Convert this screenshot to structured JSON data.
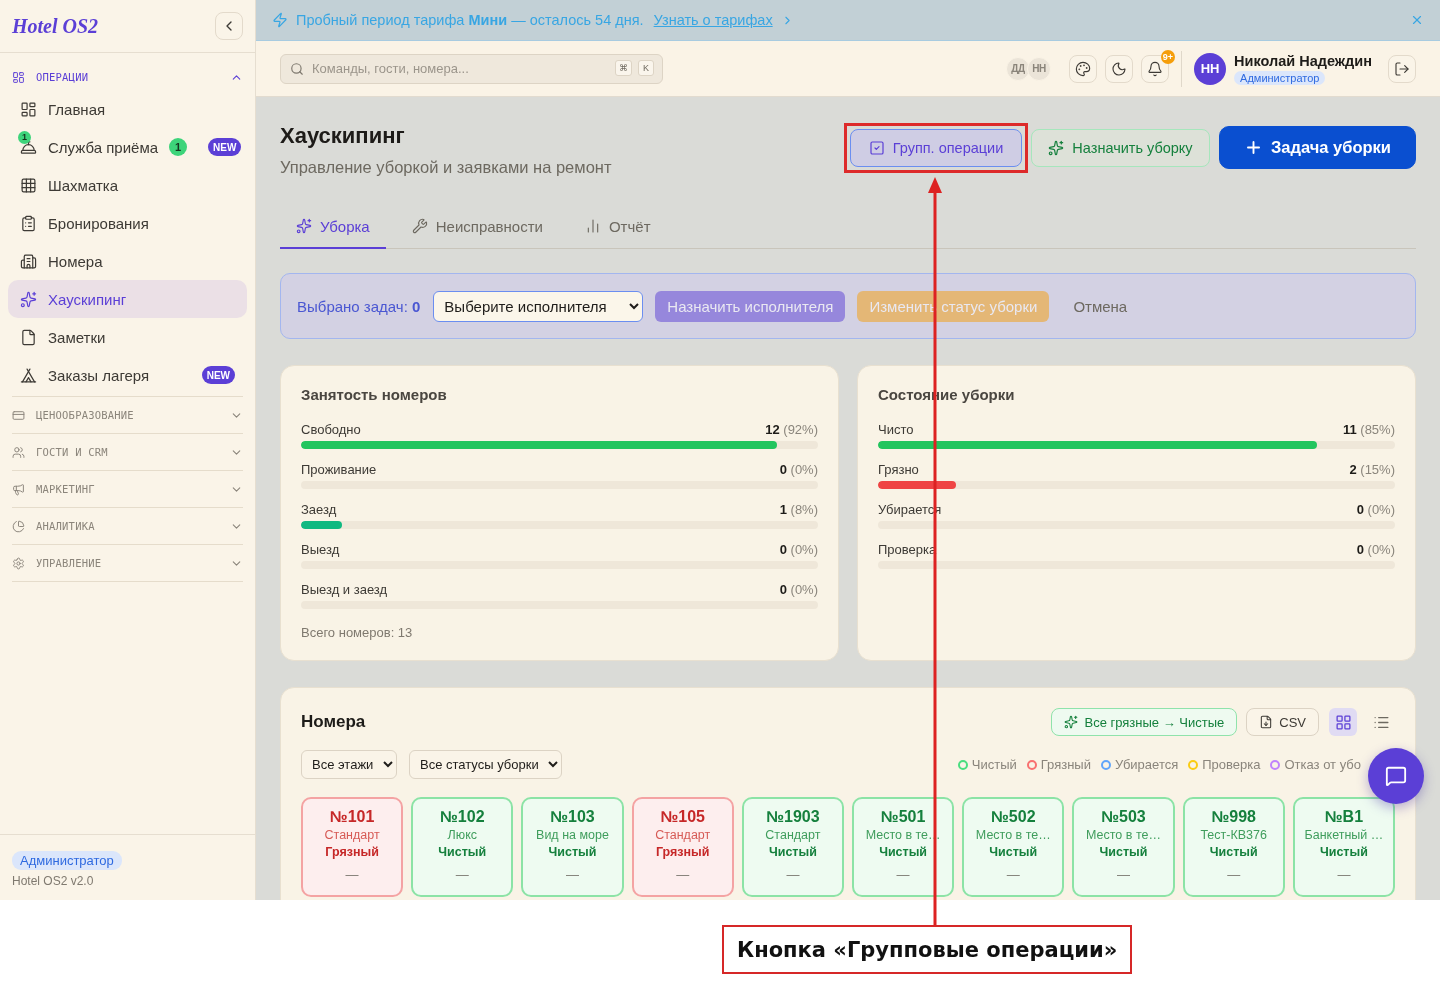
{
  "sidebar": {
    "logo": "Hotel OS2",
    "sections": [
      {
        "title": "ОПЕРАЦИИ",
        "expanded": true,
        "items": [
          {
            "label": "Главная",
            "selected": false
          },
          {
            "label": "Служба приёма",
            "selected": false,
            "icon_badge": "1",
            "count": "1",
            "tag": "NEW"
          },
          {
            "label": "Шахматка",
            "selected": false
          },
          {
            "label": "Бронирования",
            "selected": false
          },
          {
            "label": "Номера",
            "selected": false
          },
          {
            "label": "Хаускипинг",
            "selected": true
          },
          {
            "label": "Заметки",
            "selected": false
          },
          {
            "label": "Заказы лагеря",
            "selected": false,
            "tag": "NEW"
          }
        ]
      },
      {
        "title": "ЦЕНООБРАЗОВАНИЕ",
        "expanded": false
      },
      {
        "title": "ГОСТИ И CRM",
        "expanded": false
      },
      {
        "title": "МАРКЕТИНГ",
        "expanded": false
      },
      {
        "title": "АНАЛИТИКА",
        "expanded": false
      },
      {
        "title": "УПРАВЛЕНИЕ",
        "expanded": false
      }
    ],
    "footer": {
      "role": "Администратор",
      "version": "Hotel OS2 v2.0"
    }
  },
  "banner": {
    "message": "Пробный период тарифа **Мини** — осталось 54 дня.",
    "link": "Узнать о тарифах"
  },
  "topbar": {
    "search": {
      "placeholder": "Команды, гости, номера...",
      "keys": [
        "⌘",
        "K"
      ]
    },
    "online_users": [
      "ДД",
      "НН"
    ],
    "notifications_count": "9+",
    "user": {
      "initials": "НН",
      "name": "Николай Надеждин",
      "role": "Администратор"
    }
  },
  "page": {
    "title": "Хаускипинг",
    "subtitle": "Управление уборкой и заявками на ремонт",
    "actions": [
      {
        "label": "Групп. операции",
        "kind": "toggle",
        "on": true,
        "highlighted": true
      },
      {
        "label": "Назначить уборку",
        "kind": "success"
      },
      {
        "label": "Задача уборки",
        "kind": "primary"
      }
    ]
  },
  "tabs": [
    {
      "label": "Уборка",
      "selected": true
    },
    {
      "label": "Неисправности",
      "selected": false
    },
    {
      "label": "Отчёт",
      "selected": false
    }
  ],
  "bulk_bar": {
    "label": "Выбрано задач:",
    "count": "0",
    "assignee": {
      "value": "Выберите исполнителя"
    },
    "buttons": [
      {
        "label": "Назначить исполнителя",
        "kind": "purple",
        "disabled": true
      },
      {
        "label": "Изменить статус уборки",
        "kind": "amber",
        "disabled": true
      },
      {
        "label": "Отмена",
        "kind": "plain",
        "disabled": false
      }
    ]
  },
  "occupancy": {
    "title": "Занятость номеров",
    "rows": [
      {
        "label": "Свободно",
        "count": "12",
        "percent": "(92%)",
        "level": 0.92,
        "color": "#22c55e"
      },
      {
        "label": "Проживание",
        "count": "0",
        "percent": "(0%)"
      },
      {
        "label": "Заезд",
        "count": "1",
        "percent": "(8%)",
        "level": 0.08,
        "color": "#10b981"
      },
      {
        "label": "Выезд",
        "count": "0",
        "percent": "(0%)"
      },
      {
        "label": "Выезд и заезд",
        "count": "0",
        "percent": "(0%)"
      }
    ],
    "total": "Всего номеров: 13"
  },
  "cleaning": {
    "title": "Состояние уборки",
    "rows": [
      {
        "label": "Чисто",
        "count": "11",
        "percent": "(85%)",
        "level": 0.85,
        "color": "#22c55e"
      },
      {
        "label": "Грязно",
        "count": "2",
        "percent": "(15%)",
        "level": 0.15,
        "color": "#ef4444"
      },
      {
        "label": "Убирается",
        "count": "0",
        "percent": "(0%)"
      },
      {
        "label": "Проверка",
        "count": "0",
        "percent": "(0%)"
      }
    ]
  },
  "rooms": {
    "title": "Номера",
    "bulk_action": "Все грязные → Чистые",
    "export": "CSV",
    "views": [
      {
        "selected": true
      },
      {
        "selected": false
      }
    ],
    "filters": [
      {
        "value": "Все этажи"
      },
      {
        "value": "Все статусы уборки"
      }
    ],
    "legend": [
      {
        "label": "Чистый",
        "color": "#4ade80"
      },
      {
        "label": "Грязный",
        "color": "#f87171"
      },
      {
        "label": "Убирается",
        "color": "#60a5fa"
      },
      {
        "label": "Проверка",
        "color": "#facc15"
      },
      {
        "label": "Отказ от убо",
        "color": "#c084fc"
      }
    ],
    "cards": [
      {
        "number": "№101",
        "type": "Стандарт",
        "status": "Грязный",
        "kind": "dirty",
        "assignee": "—"
      },
      {
        "number": "№102",
        "type": "Люкс",
        "status": "Чистый",
        "kind": "clean",
        "assignee": "—"
      },
      {
        "number": "№103",
        "type": "Вид на море",
        "status": "Чистый",
        "kind": "clean",
        "assignee": "—"
      },
      {
        "number": "№105",
        "type": "Стандарт",
        "status": "Грязный",
        "kind": "dirty",
        "assignee": "—"
      },
      {
        "number": "№1903",
        "type": "Стандарт",
        "status": "Чистый",
        "kind": "clean",
        "assignee": "—"
      },
      {
        "number": "№501",
        "type": "Место в те…",
        "status": "Чистый",
        "kind": "clean",
        "assignee": "—"
      },
      {
        "number": "№502",
        "type": "Место в те…",
        "status": "Чистый",
        "kind": "clean",
        "assignee": "—"
      },
      {
        "number": "№503",
        "type": "Место в те…",
        "status": "Чистый",
        "kind": "clean",
        "assignee": "—"
      },
      {
        "number": "№998",
        "type": "Тест-КВ376",
        "status": "Чистый",
        "kind": "clean",
        "assignee": "—"
      },
      {
        "number": "№B1",
        "type": "Банкетный …",
        "status": "Чистый",
        "kind": "clean",
        "assignee": "—"
      }
    ]
  },
  "callout": {
    "text": "Кнопка «Групповые операции»"
  }
}
